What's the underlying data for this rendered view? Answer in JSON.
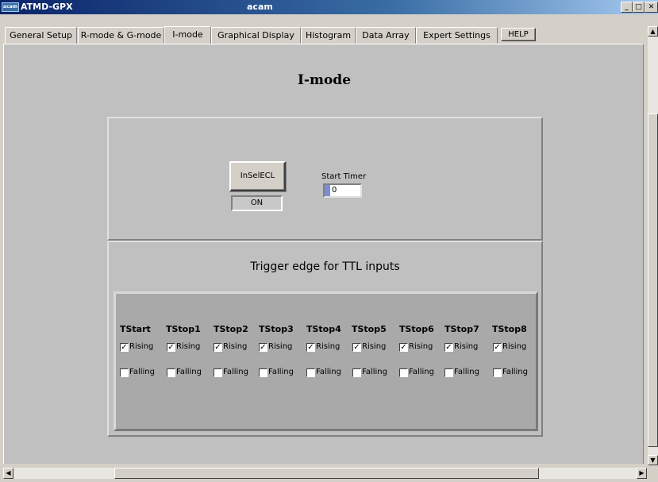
{
  "window": {
    "app_title": "ATMD-GPX",
    "title": "acam",
    "app_icon": "acam",
    "controls": [
      "minimize",
      "maximize",
      "close"
    ]
  },
  "tabs": [
    {
      "label": "General Setup",
      "active": false
    },
    {
      "label": "R-mode & G-mode",
      "active": false
    },
    {
      "label": "I-mode",
      "active": true
    },
    {
      "label": "Graphical Display",
      "active": false
    },
    {
      "label": "Histogram",
      "active": false
    },
    {
      "label": "Data Array",
      "active": false
    },
    {
      "label": "Expert Settings",
      "active": false
    }
  ],
  "help_label": "HELP",
  "page_title": "I-mode",
  "top_panel": {
    "insel_button": "InSelECL",
    "insel_state": "ON",
    "start_timer_label": "Start Timer",
    "start_timer_value": "0"
  },
  "edge_panel": {
    "title": "Trigger edge for TTL inputs",
    "rising_label": "Rising",
    "falling_label": "Falling",
    "inputs": [
      {
        "name": "TStart",
        "rising": true,
        "falling": false
      },
      {
        "name": "TStop1",
        "rising": true,
        "falling": false
      },
      {
        "name": "TStop2",
        "rising": true,
        "falling": false
      },
      {
        "name": "TStop3",
        "rising": true,
        "falling": false
      },
      {
        "name": "TStop4",
        "rising": true,
        "falling": false
      },
      {
        "name": "TStop5",
        "rising": true,
        "falling": false
      },
      {
        "name": "TStop6",
        "rising": true,
        "falling": false
      },
      {
        "name": "TStop7",
        "rising": true,
        "falling": false
      },
      {
        "name": "TStop8",
        "rising": true,
        "falling": false
      }
    ]
  },
  "colors": {
    "titlebar": "#0a246a",
    "window_bg": "#d4d0c8",
    "panel_bg": "#c0c0c0",
    "edge_panel_bg": "#a9a9a9",
    "spinner_accent": "#7a8fd8"
  }
}
